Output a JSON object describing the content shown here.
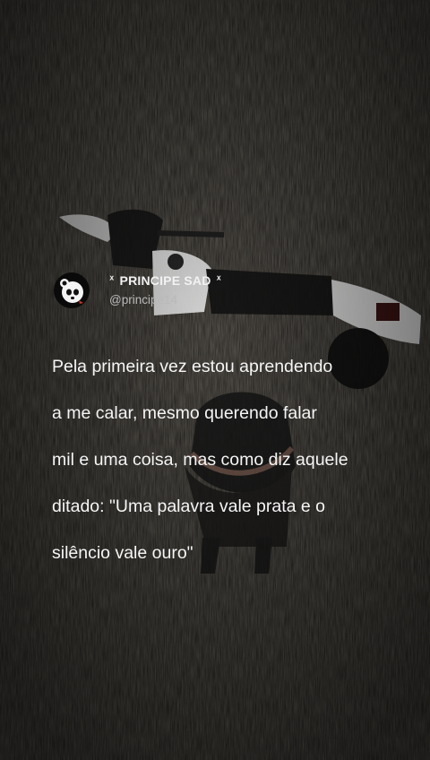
{
  "post": {
    "display_name": "PRINCIPE SAD",
    "name_decoration_left": "ᕽ",
    "name_decoration_right": "ᕽ",
    "handle": "@principe14",
    "avatar_icon": "panda-avatar-icon",
    "text_lines": [
      "Pela primeira vez estou aprendendo",
      "a me calar, mesmo querendo falar",
      "mil e uma coisa, mas como diz aquele",
      "ditado: \"Uma palavra vale prata e o",
      "silêncio vale ouro\""
    ]
  },
  "colors": {
    "text": "#f5f5f5",
    "handle": "#b9b9b9",
    "background": "#1c1b19"
  }
}
